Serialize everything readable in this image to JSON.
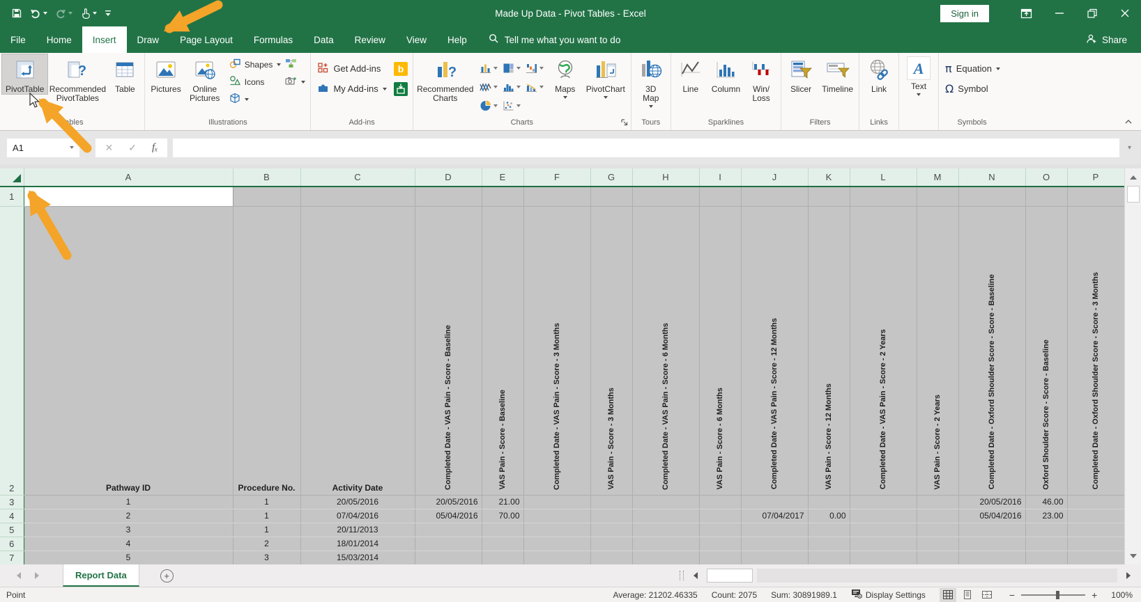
{
  "colors": {
    "excel_green": "#217346",
    "header_underline": "#1E7044",
    "arrow_orange": "#F4A428",
    "cell_gray": "#C5C5C5",
    "accent_blue": "#2E75B6"
  },
  "title_bar": {
    "title": "Made Up Data - Pivot Tables  -  Excel",
    "sign_in_label": "Sign in"
  },
  "ribbon_tabs": {
    "file": "File",
    "home": "Home",
    "insert": "Insert",
    "draw": "Draw",
    "page_layout": "Page Layout",
    "formulas": "Formulas",
    "data": "Data",
    "review": "Review",
    "view": "View",
    "help": "Help",
    "tell_me": "Tell me what you want to do",
    "share": "Share"
  },
  "ribbon": {
    "tables_group": {
      "label": "Tables",
      "pivottable": "PivotTable",
      "recommended_pivottables": "Recommended PivotTables",
      "table": "Table"
    },
    "illustrations_group": {
      "label": "Illustrations",
      "pictures": "Pictures",
      "online_pictures": "Online Pictures",
      "shapes": "Shapes",
      "icons": "Icons"
    },
    "addins_group": {
      "label": "Add-ins",
      "get_addins": "Get Add-ins",
      "my_addins": "My Add-ins"
    },
    "charts_group": {
      "label": "Charts",
      "recommended_charts": "Recommended Charts",
      "maps": "Maps",
      "pivotchart": "PivotChart"
    },
    "tours_group": {
      "label": "Tours",
      "map_3d": "3D Map"
    },
    "sparklines_group": {
      "label": "Sparklines",
      "line": "Line",
      "column": "Column",
      "win_loss": "Win/ Loss"
    },
    "filters_group": {
      "label": "Filters",
      "slicer": "Slicer",
      "timeline": "Timeline"
    },
    "links_group": {
      "label": "Links",
      "link": "Link"
    },
    "text_group": {
      "text": "Text"
    },
    "symbols_group": {
      "label": "Symbols",
      "equation": "Equation",
      "symbol": "Symbol"
    }
  },
  "formula_bar": {
    "name_box": "A1",
    "formula_value": ""
  },
  "sheet": {
    "columns": [
      "A",
      "B",
      "C",
      "D",
      "E",
      "F",
      "G",
      "H",
      "I",
      "J",
      "K",
      "L",
      "M",
      "N",
      "O",
      "P"
    ],
    "row_numbers": [
      "1",
      "2",
      "3",
      "4",
      "5",
      "6",
      "7"
    ],
    "header_row": {
      "A": "Pathway ID",
      "B": "Procedure No.",
      "C": "Activity Date",
      "D": "Completed Date - VAS Pain - Score - Baseline",
      "E": "VAS Pain - Score - Baseline",
      "F": "Completed Date - VAS Pain - Score - 3 Months",
      "G": "VAS Pain - Score - 3 Months",
      "H": "Completed Date - VAS Pain - Score - 6 Months",
      "I": "VAS Pain - Score - 6 Months",
      "J": "Completed Date - VAS Pain - Score - 12 Months",
      "K": "VAS Pain - Score - 12 Months",
      "L": "Completed Date - VAS Pain - Score - 2 Years",
      "M": "VAS Pain - Score - 2 Years",
      "N": "Completed Date - Oxford Shoulder Score - Score - Baseline",
      "O": "Oxford Shoulder Score - Score - Baseline",
      "P": "Completed Date - Oxford Shoulder Score - Score - 3 Months"
    },
    "r3": {
      "A": "1",
      "B": "1",
      "C": "20/05/2016",
      "D": "20/05/2016",
      "E": "21.00",
      "N": "20/05/2016",
      "O": "46.00"
    },
    "r4": {
      "A": "2",
      "B": "1",
      "C": "07/04/2016",
      "D": "05/04/2016",
      "E": "70.00",
      "J": "07/04/2017",
      "K": "0.00",
      "N": "05/04/2016",
      "O": "23.00"
    },
    "r5": {
      "A": "3",
      "B": "1",
      "C": "20/11/2013"
    },
    "r6": {
      "A": "4",
      "B": "2",
      "C": "18/01/2014"
    },
    "r7": {
      "A": "5",
      "B": "3",
      "C": "15/03/2014"
    }
  },
  "sheet_tabs": {
    "active_tab": "Report Data"
  },
  "status_bar": {
    "mode": "Point",
    "average": "Average: 21202.46335",
    "count": "Count: 2075",
    "sum": "Sum: 30891989.1",
    "display_settings": "Display Settings",
    "zoom_level": "100%"
  }
}
